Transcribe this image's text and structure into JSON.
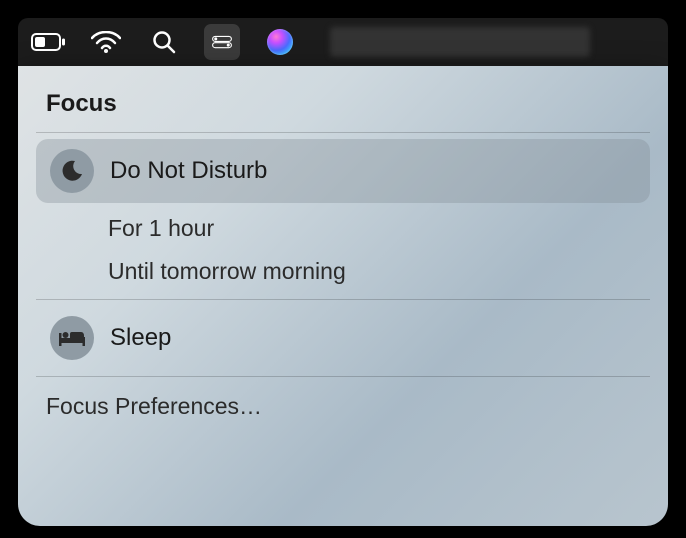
{
  "menubar": {
    "icons": {
      "battery": "battery-icon",
      "wifi": "wifi-icon",
      "search": "search-icon",
      "control_center": "control-center-icon",
      "siri": "siri-icon"
    }
  },
  "panel": {
    "title": "Focus",
    "modes": [
      {
        "id": "do-not-disturb",
        "label": "Do Not Disturb",
        "icon": "moon-icon",
        "selected": true,
        "options": [
          "For 1 hour",
          "Until tomorrow morning"
        ]
      },
      {
        "id": "sleep",
        "label": "Sleep",
        "icon": "bed-icon",
        "selected": false,
        "options": []
      }
    ],
    "preferences_label": "Focus Preferences…"
  }
}
